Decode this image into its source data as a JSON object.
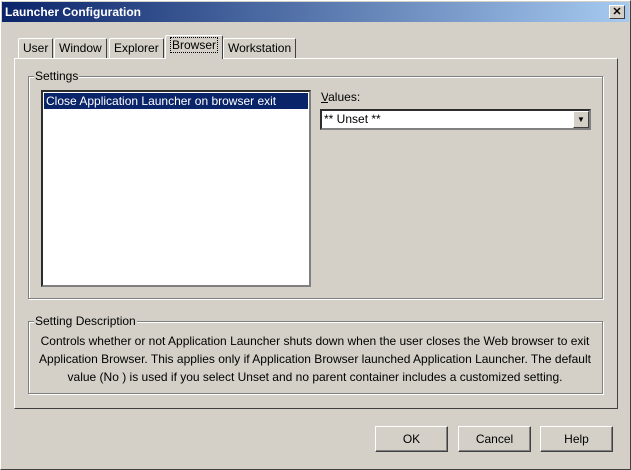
{
  "window": {
    "title": "Launcher Configuration"
  },
  "tabs": [
    {
      "label": "User"
    },
    {
      "label": "Window"
    },
    {
      "label": "Explorer"
    },
    {
      "label": "Browser"
    },
    {
      "label": "Workstation"
    }
  ],
  "settings": {
    "legend": "Settings",
    "items": [
      "Close Application Launcher on browser exit"
    ]
  },
  "values": {
    "label": "Values:",
    "selected": "** Unset **"
  },
  "description": {
    "legend": "Setting Description",
    "text": "Controls whether or not Application Launcher shuts down when the user closes the Web browser to exit Application Browser. This applies only if Application Browser launched Application Launcher. The default value (No ) is used if you select Unset and no parent container includes a customized setting."
  },
  "buttons": {
    "ok": "OK",
    "cancel": "Cancel",
    "help": "Help"
  }
}
